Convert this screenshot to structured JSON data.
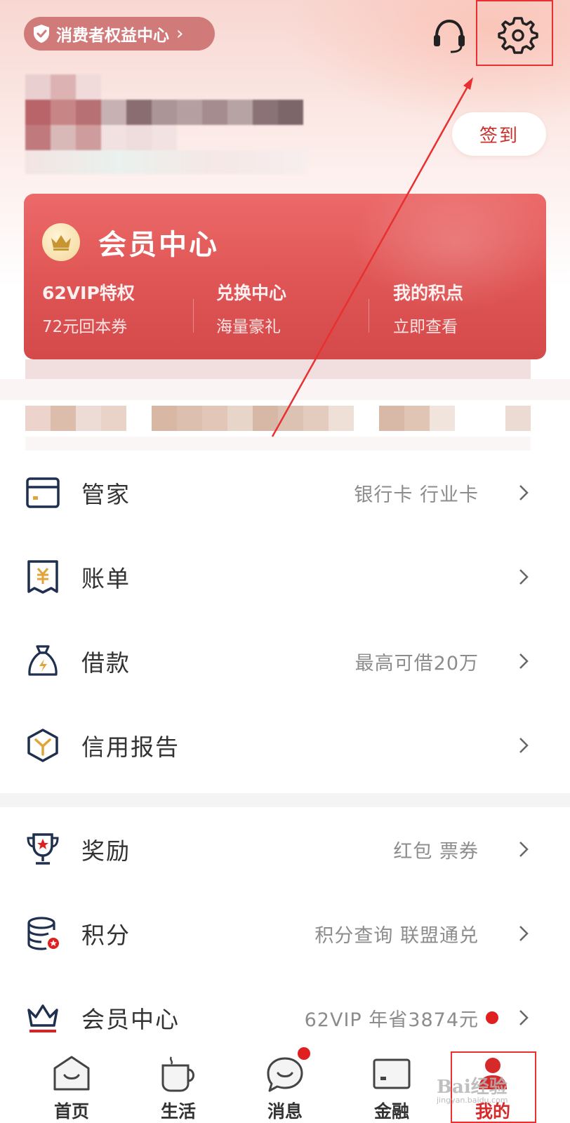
{
  "header": {
    "rights_center": "消费者权益中心",
    "checkin": "签到"
  },
  "member_card": {
    "title": "会员中心",
    "perks": [
      {
        "title": "62VIP特权",
        "sub": "72元回本券"
      },
      {
        "title": "兑换中心",
        "sub": "海量豪礼"
      },
      {
        "title": "我的积点",
        "sub": "立即查看"
      }
    ]
  },
  "menu": [
    {
      "label": "管家",
      "hint": "银行卡 行业卡",
      "icon": "card-icon"
    },
    {
      "label": "账单",
      "hint": "",
      "icon": "bill-icon"
    },
    {
      "label": "借款",
      "hint": "最高可借20万",
      "icon": "loan-bag-icon"
    },
    {
      "label": "信用报告",
      "hint": "",
      "icon": "credit-report-icon"
    },
    {
      "label": "奖励",
      "hint": "红包 票券",
      "icon": "trophy-icon"
    },
    {
      "label": "积分",
      "hint": "积分查询 联盟通兑",
      "icon": "points-coins-icon"
    },
    {
      "label": "会员中心",
      "hint": "62VIP 年省3874元",
      "icon": "crown-icon"
    }
  ],
  "bottom_nav": [
    {
      "label": "首页",
      "icon": "home-icon"
    },
    {
      "label": "生活",
      "icon": "cup-icon"
    },
    {
      "label": "消息",
      "icon": "message-icon"
    },
    {
      "label": "金融",
      "icon": "finance-card-icon"
    },
    {
      "label": "我的",
      "icon": "profile-icon"
    }
  ],
  "watermark": {
    "main": "Bai经验",
    "sub": "jingyan.baidu.com"
  },
  "colors": {
    "brand_red": "#d5292a",
    "card_red": "#e05858",
    "annotation_red": "#e83030"
  }
}
